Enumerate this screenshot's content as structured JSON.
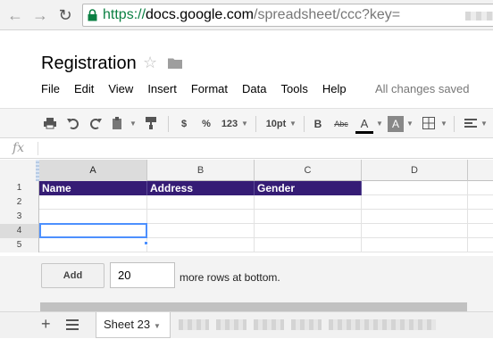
{
  "browser": {
    "url_scheme": "https://",
    "url_host": "docs.google.com",
    "url_path": "/spreadsheet/ccc?key="
  },
  "document": {
    "title": "Registration",
    "save_status": "All changes saved"
  },
  "menu": [
    "File",
    "Edit",
    "View",
    "Insert",
    "Format",
    "Data",
    "Tools",
    "Help"
  ],
  "toolbar": {
    "currency": "$",
    "percent": "%",
    "number_format": "123",
    "font_size": "10pt",
    "bold": "B",
    "strikethrough": "Abc",
    "text_color": "A",
    "highlight": "A"
  },
  "formula_bar": {
    "fx": "fx"
  },
  "grid": {
    "columns": [
      "A",
      "B",
      "C",
      "D"
    ],
    "rows": [
      "1",
      "2",
      "3",
      "4",
      "5"
    ],
    "header_row": [
      "Name",
      "Address",
      "Gender"
    ],
    "header_color": "#351c75",
    "active_cell": "A4"
  },
  "add_rows": {
    "button_label": "Add",
    "count": "20",
    "label": "more rows at bottom."
  },
  "sheets": {
    "active_tab": "Sheet 23"
  }
}
